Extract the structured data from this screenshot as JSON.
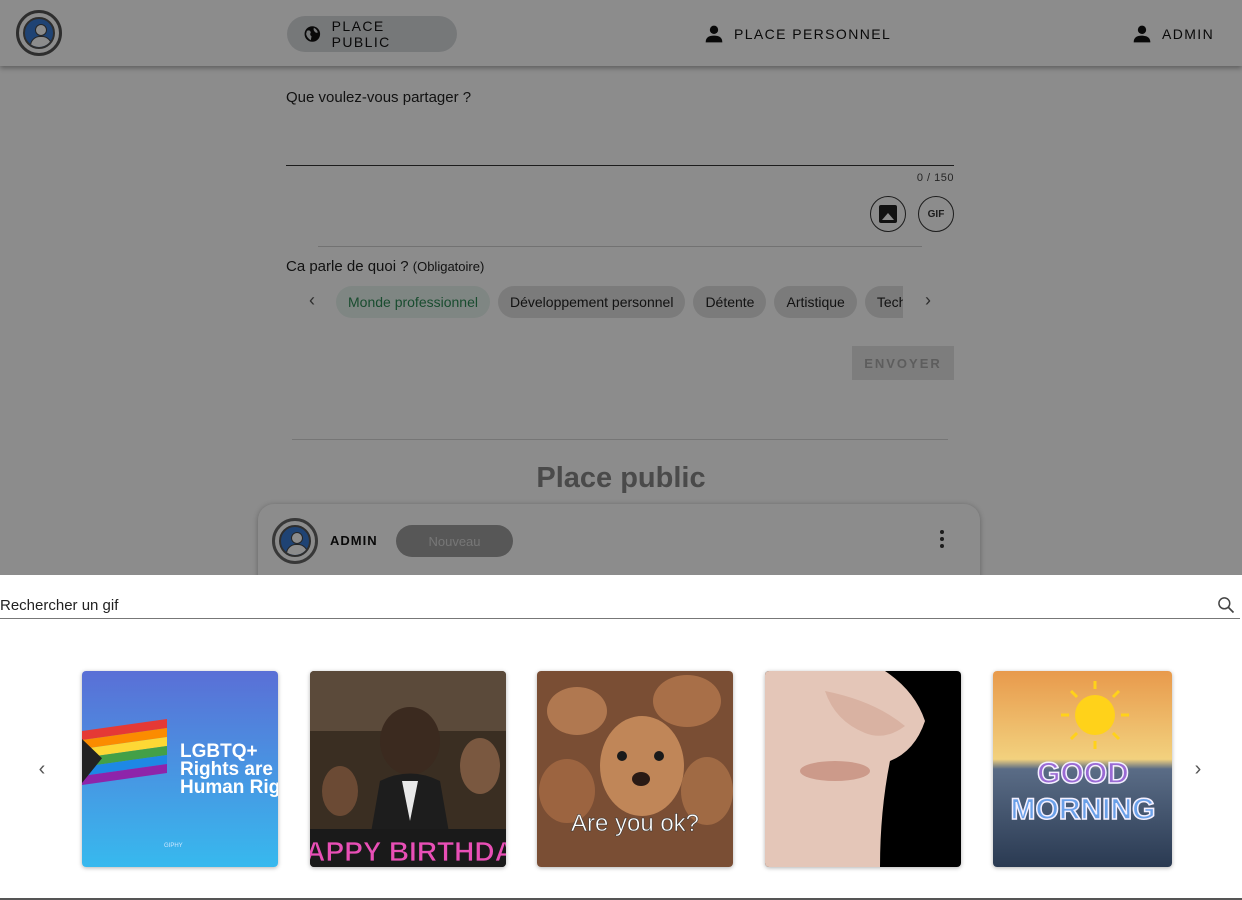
{
  "header": {
    "nav_public": "PLACE PUBLIC",
    "nav_personal": "PLACE PERSONNEL",
    "nav_admin": "ADMIN"
  },
  "composer": {
    "prompt": "Que voulez-vous partager ?",
    "counter": "0 / 150",
    "gif_button": "GIF",
    "topic_label": "Ca parle de quoi ?",
    "topic_required": "(Obligatoire)",
    "topics": [
      "Monde professionnel",
      "Développement personnel",
      "Détente",
      "Artistique",
      "Techno"
    ],
    "selected_topic": "Monde professionnel",
    "send_label": "ENVOYER"
  },
  "feed": {
    "title": "Place public",
    "post": {
      "author": "ADMIN",
      "badge": "Nouveau"
    }
  },
  "gif_drawer": {
    "search_placeholder": "Rechercher un gif",
    "tiles": [
      {
        "caption": "LGBTQ+ Rights are Human Rig",
        "watermark": "GIPHY"
      },
      {
        "caption": "HAPPY BIRTHDAY"
      },
      {
        "caption": "Are you ok?"
      },
      {
        "caption": ""
      },
      {
        "caption": "GOOD MORNING"
      }
    ]
  },
  "colors": {
    "accent_green": "#2e8b57",
    "scrim": "rgba(0,0,0,0.45)",
    "chip_bg": "#e0e0e0"
  }
}
